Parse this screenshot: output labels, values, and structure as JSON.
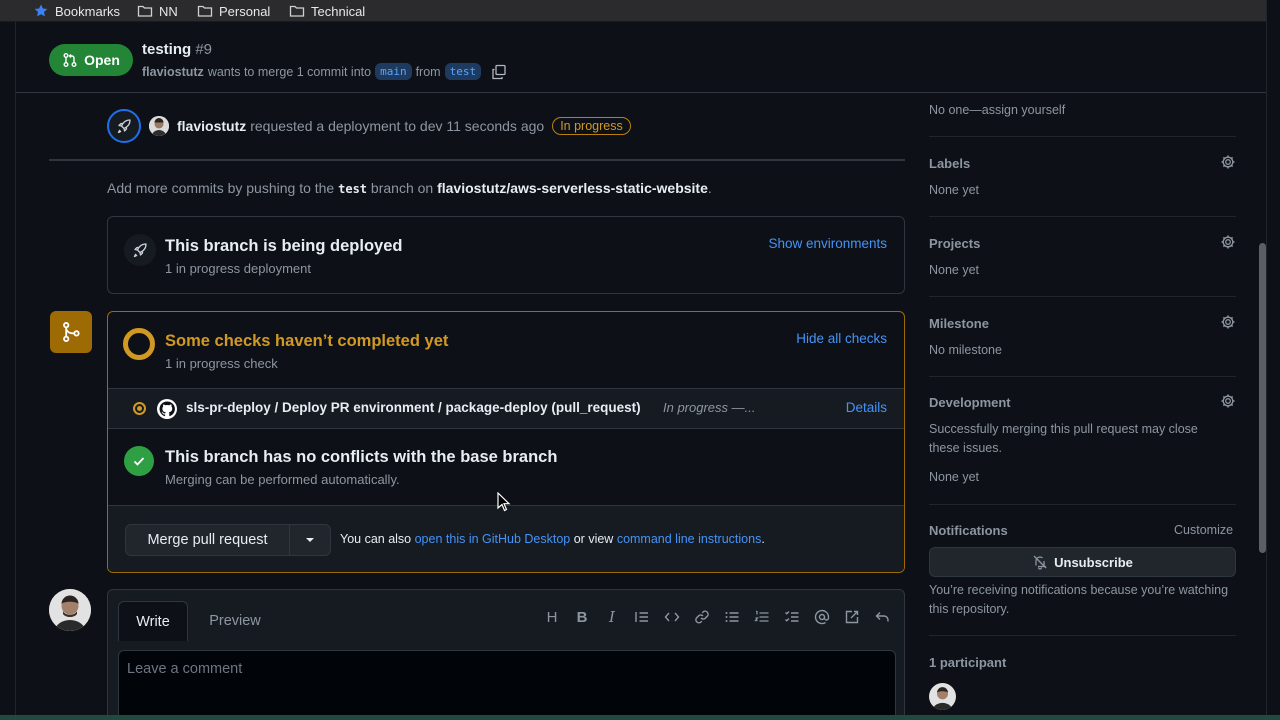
{
  "bookmarks": [
    {
      "label": "Bookmarks",
      "icon": "star-icon"
    },
    {
      "label": "NN",
      "icon": "folder-icon"
    },
    {
      "label": "Personal",
      "icon": "folder-icon"
    },
    {
      "label": "Technical",
      "icon": "folder-icon"
    }
  ],
  "header": {
    "status": "Open",
    "title": "testing",
    "number": "#9",
    "author": "flaviostutz",
    "meta_text": "wants to merge 1 commit into",
    "base_branch": "main",
    "from_text": "from",
    "head_branch": "test"
  },
  "timeline": {
    "deploy_user": "flaviostutz",
    "deploy_text": "requested a deployment to dev 11 seconds ago",
    "deploy_badge": "In progress",
    "add_commits_pre": "Add more commits by pushing to the",
    "add_commits_branch": "test",
    "add_commits_mid": "branch on",
    "add_commits_repo": "flaviostutz/aws-serverless-static-website",
    "add_commits_end": "."
  },
  "deploy_box": {
    "title": "This branch is being deployed",
    "subtitle": "1 in progress deployment",
    "action": "Show environments"
  },
  "checks": {
    "title": "Some checks haven’t completed yet",
    "subtitle": "1 in progress check",
    "action": "Hide all checks",
    "check_name": "sls-pr-deploy / Deploy PR environment / package-deploy (pull_request)",
    "check_status": "In progress —...",
    "check_details": "Details",
    "conflicts_title": "This branch has no conflicts with the base branch",
    "conflicts_subtitle": "Merging can be performed automatically.",
    "merge_button": "Merge pull request",
    "also_text": "You can also",
    "desktop_link": "open this in GitHub Desktop",
    "or_view": "or view",
    "cli_link": "command line instructions",
    "period": "."
  },
  "comment": {
    "tab_write": "Write",
    "tab_preview": "Preview",
    "placeholder": "Leave a comment",
    "toolbar": [
      "H",
      "B",
      "I",
      "quote",
      "code",
      "link",
      "ul",
      "ol",
      "tasklist",
      "mention",
      "reference",
      "undo"
    ]
  },
  "sidebar": {
    "assignees_text": "No one—assign yourself",
    "labels_title": "Labels",
    "labels_value": "None yet",
    "projects_title": "Projects",
    "projects_value": "None yet",
    "milestone_title": "Milestone",
    "milestone_value": "No milestone",
    "development_title": "Development",
    "development_text": "Successfully merging this pull request may close these issues.",
    "development_value": "None yet",
    "notifications_title": "Notifications",
    "notifications_action": "Customize",
    "unsubscribe": "Unsubscribe",
    "notifications_text": "You’re receiving notifications because you’re watching this repository.",
    "participants_title": "1 participant"
  },
  "colors": {
    "open_green": "#238636",
    "pending_yellow": "#d29922",
    "link_blue": "#4493f8",
    "success_green": "#2ea043"
  }
}
